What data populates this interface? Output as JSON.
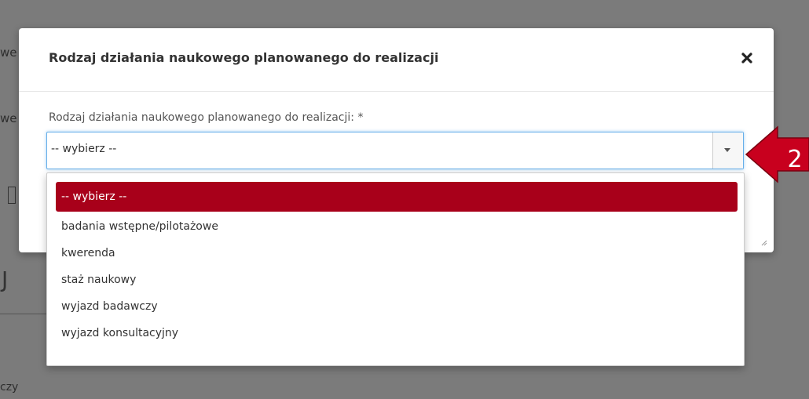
{
  "modal": {
    "title": "Rodzaj działania naukowego planowanego do realizacji",
    "field_label": "Rodzaj działania naukowego planowanego do realizacji: *",
    "close_icon": "close-icon"
  },
  "select": {
    "value": "-- wybierz --"
  },
  "dropdown": {
    "options": [
      "-- wybierz --",
      "badania wstępne/pilotażowe",
      "kwerenda",
      "staż naukowy",
      "wyjazd badawczy",
      "wyjazd konsultacyjny"
    ],
    "selected_index": 0
  },
  "annotation": {
    "number": "2",
    "color": "#c8001e"
  },
  "background": {
    "fragment_we_1": "we",
    "fragment_we_2": "we",
    "fragment_j": "J",
    "fragment_czy": "czy"
  },
  "colors": {
    "selected_option_bg": "#a8001a",
    "select_focus_border": "#66afe9",
    "overlay": "#7b7b7b"
  }
}
